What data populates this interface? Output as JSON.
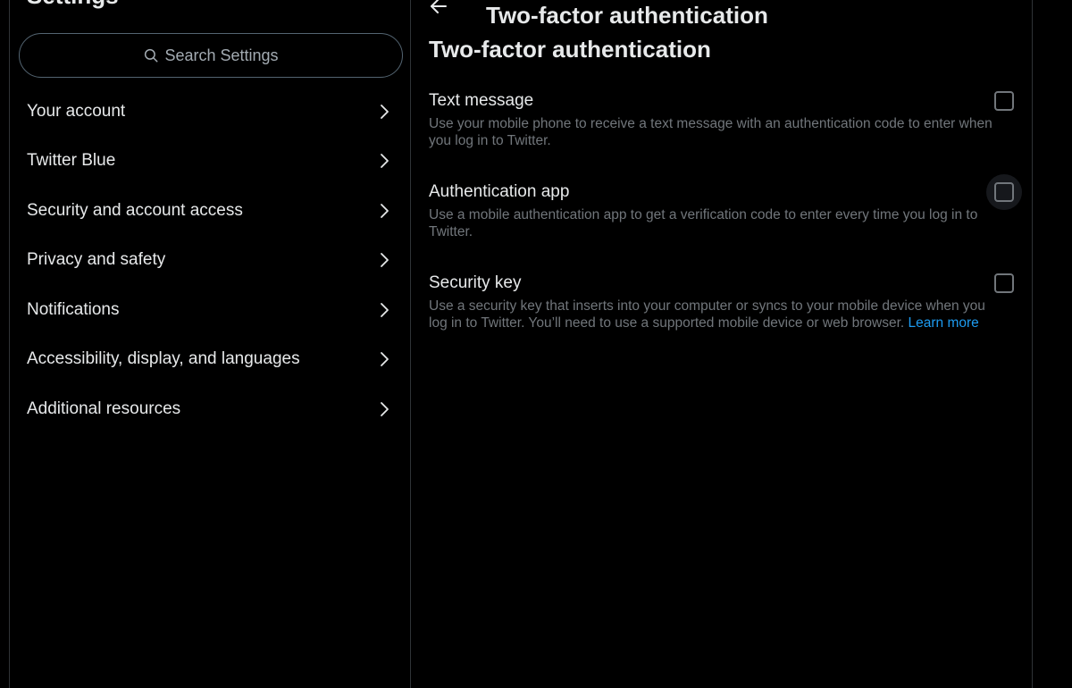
{
  "settings": {
    "title": "Settings",
    "search_placeholder": "Search Settings",
    "nav_items": [
      {
        "label": "Your account"
      },
      {
        "label": "Twitter Blue"
      },
      {
        "label": "Security and account access"
      },
      {
        "label": "Privacy and safety"
      },
      {
        "label": "Notifications"
      },
      {
        "label": "Accessibility, display, and languages"
      },
      {
        "label": "Additional resources"
      }
    ]
  },
  "two_factor": {
    "header_title": "Two-factor authentication",
    "section_title": "Two-factor authentication",
    "options": [
      {
        "title": "Text message",
        "description": "Use your mobile phone to receive a text message with an authentication code to enter when you log in to Twitter.",
        "checked": false
      },
      {
        "title": "Authentication app",
        "description": "Use a mobile authentication app to get a verification code to enter every time you log in to Twitter.",
        "checked": false
      },
      {
        "title": "Security key",
        "description": "Use a security key that inserts into your computer or syncs to your mobile device when you log in to Twitter. You’ll need to use a supported mobile device or web browser.",
        "link_text": "Learn more",
        "checked": false
      }
    ]
  },
  "colors": {
    "background": "#000000",
    "text_primary": "#e7e9ea",
    "text_secondary": "#71767b",
    "link": "#1d9bf0",
    "border": "#2f3336"
  },
  "icons": {
    "search": "search-icon",
    "chevron": "chevron-right-icon",
    "back": "arrow-left-icon"
  }
}
